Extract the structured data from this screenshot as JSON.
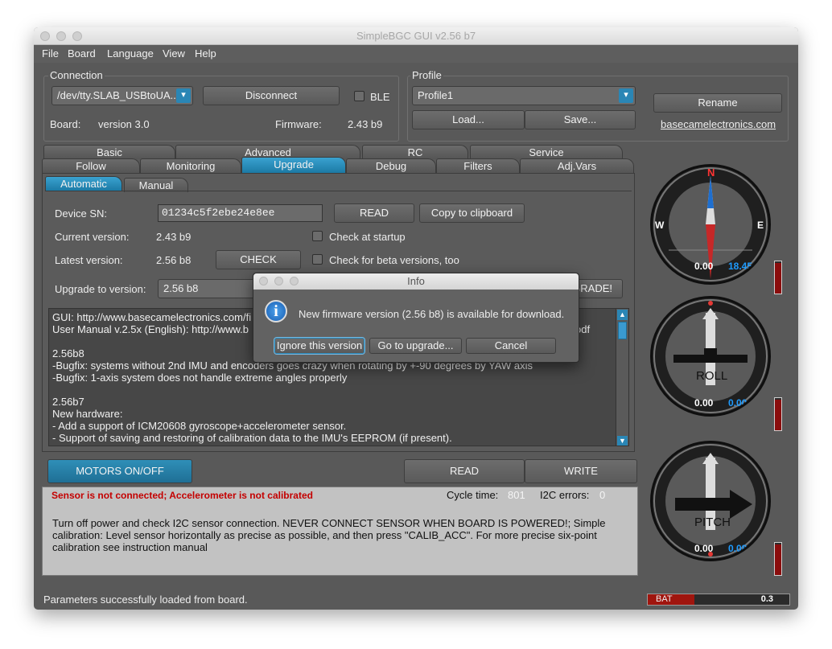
{
  "window": {
    "title": "SimpleBGC GUI v2.56 b7"
  },
  "menu": [
    "File",
    "Board",
    "Language",
    "View",
    "Help"
  ],
  "connection": {
    "group_label": "Connection",
    "port": "/dev/tty.SLAB_USBtoUA...",
    "disconnect_label": "Disconnect",
    "ble_label": "BLE",
    "board_label": "Board:",
    "board_value": "version 3.0",
    "firmware_label": "Firmware:",
    "firmware_value": "2.43 b9"
  },
  "profile": {
    "group_label": "Profile",
    "selected": "Profile1",
    "load_label": "Load...",
    "save_label": "Save...",
    "rename_label": "Rename",
    "website_link": "basecamelectronics.com"
  },
  "tabs_top": [
    "Basic",
    "Advanced",
    "RC",
    "Service"
  ],
  "tabs_bottom": [
    "Follow",
    "Monitoring",
    "Upgrade",
    "Debug",
    "Filters",
    "Adj.Vars"
  ],
  "subtabs": [
    "Automatic",
    "Manual"
  ],
  "upgrade": {
    "device_sn_label": "Device SN:",
    "device_sn_value": "01234c5f2ebe24e8ee",
    "read_label": "READ",
    "copy_label": "Copy to clipboard",
    "current_version_label": "Current version:",
    "current_version_value": "2.43 b9",
    "check_startup_label": "Check at startup",
    "latest_version_label": "Latest version:",
    "latest_version_value": "2.56 b8",
    "check_label": "CHECK",
    "check_beta_label": "Check for beta versions, too",
    "upgrade_to_label": "Upgrade to version:",
    "upgrade_to_value": "2.56 b8",
    "upgrade_button_label": "GRADE!"
  },
  "changelog": [
    "GUI: http://www.basecamelectronics.com/fi",
    "User Manual v.2.5x (English): http://www.b",
    "",
    "2.56b8",
    "-Bugfix: systems without 2nd IMU and encoders goes crazy when rotating by +-90 degrees by YAW axis",
    "-Bugfix: 1-axis system does not handle extreme angles properly",
    "",
    "2.56b7",
    "New hardware:",
    "- Add a support of ICM20608 gyroscope+accelerometer sensor.",
    "- Support of saving and restoring of calibration data to the IMU's EEPROM (if present)."
  ],
  "changelog_tail": "odf",
  "bottom": {
    "motors_label": "MOTORS ON/OFF",
    "read_label": "READ",
    "write_label": "WRITE"
  },
  "status": {
    "error_text": "Sensor is not connected; Accelerometer is not calibrated",
    "cycle_label": "Cycle time:",
    "cycle_value": "801",
    "i2c_label": "I2C errors:",
    "i2c_value": "0",
    "message_lines": [
      "Turn off power and check I2C sensor connection. NEVER CONNECT SENSOR WHEN BOARD IS POWERED!; Simple",
      "calibration: Level sensor horizontally as precise as possible, and then press \"CALIB_ACC\". For more precise six-point",
      "calibration see instruction manual"
    ],
    "footer_text": "Parameters successfully loaded from board."
  },
  "battery": {
    "label": "BAT",
    "value": "0.3"
  },
  "dialog": {
    "title": "Info",
    "icon": "info-icon",
    "message": "New firmware version (2.56 b8) is available for download.",
    "ignore_label": "Ignore this version",
    "goto_label": "Go to upgrade...",
    "cancel_label": "Cancel"
  },
  "gauges": {
    "compass": {
      "n": "N",
      "e": "E",
      "w": "W",
      "val1": "0.00",
      "val2": "18.45"
    },
    "roll": {
      "label": "ROLL",
      "val1": "0.00",
      "val2": "0.00"
    },
    "pitch": {
      "label": "PITCH",
      "val1": "0.00",
      "val2": "0.08"
    }
  },
  "colors": {
    "accent": "#2a8fbd",
    "error": "#c40000",
    "blue_value": "#1e9bff"
  }
}
